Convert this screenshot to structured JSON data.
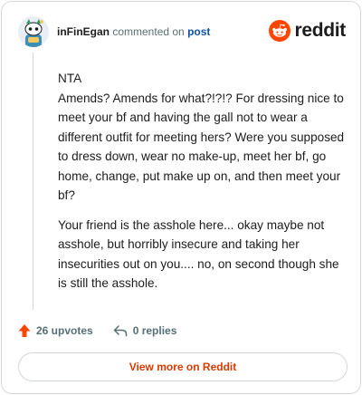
{
  "header": {
    "username": "inFinEgan",
    "verb": "commented on",
    "post_link": "post",
    "brand": "reddit",
    "brand_color": "#ff4500"
  },
  "comment": {
    "paragraphs": [
      "NTA",
      "Amends? Amends for what?!?!? For dressing nice to meet your bf and having the gall not to wear a different outfit for meeting hers? Were you supposed to dress down, wear no make-up, meet her bf, go home, change, put make up on, and then meet your bf?",
      "Your friend is the asshole here... okay maybe not asshole, but horribly insecure and taking her insecurities out on you.... no, on second though she is still the asshole."
    ]
  },
  "actions": {
    "upvotes": "26 upvotes",
    "replies": "0 replies"
  },
  "footer": {
    "view_more": "View more on Reddit"
  },
  "icons": {
    "avatar": "snoo-avatar-icon",
    "logo": "reddit-snoo-icon",
    "upvote": "upvote-arrow-icon",
    "reply": "reply-arrow-icon"
  }
}
